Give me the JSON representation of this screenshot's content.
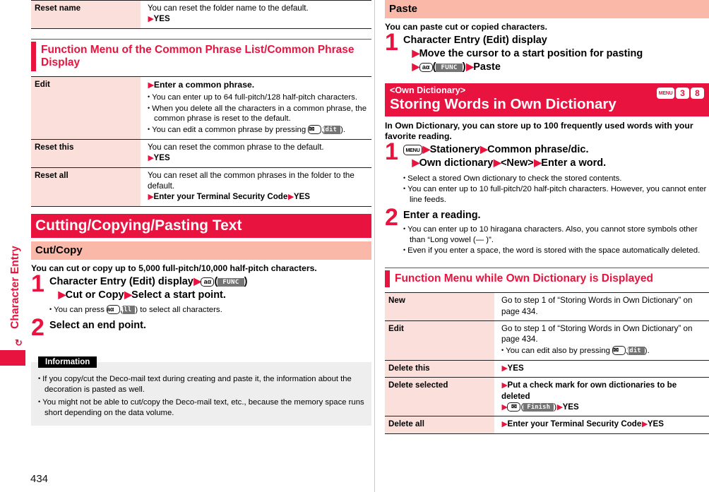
{
  "page": {
    "number": "434",
    "thumb_tab": "Character Entry",
    "accent_red": "#e8133f",
    "key_cell_bg": "#fbdfda",
    "sub_heading_bg": "#fab9a8",
    "info_bg": "#eeeeee"
  },
  "left": {
    "table_top": {
      "rows": [
        {
          "label": "Reset name",
          "lines": [
            "You can reset the folder name to the default.",
            "YES"
          ]
        }
      ]
    },
    "section_heading": "Function Menu of the Common Phrase List/Common Phrase Display",
    "table_fn": {
      "rows": [
        {
          "label": "Edit",
          "headline": "Enter a common phrase.",
          "bullets": [
            "You can enter up to 64 full-pitch/128 half-pitch characters.",
            "When you delete all the characters in a common phrase, the common phrase is reset to the default.",
            "You can edit a common phrase by pressing"
          ],
          "bullet3_key": "mail-key",
          "bullet3_soft": "Edit",
          "bullet3_tail": "."
        },
        {
          "label": "Reset this",
          "line1": "You can reset the common phrase to the default.",
          "line2": "YES"
        },
        {
          "label": "Reset all",
          "line1": "You can reset all the common phrases in the folder to the default.",
          "line2a": "Enter your Terminal Security Code",
          "line2b": "YES"
        }
      ]
    },
    "chapter_heading": "Cutting/Copying/Pasting Text",
    "sub_heading": "Cut/Copy",
    "lead": "You can cut or copy up to 5,000 full-pitch/10,000 half-pitch characters.",
    "step1": {
      "num": "1",
      "line1_a": "Character Entry (Edit) display",
      "line1_key": "i-alpha-key",
      "line1_soft": "FUNC",
      "line2_a": "Cut or Copy",
      "line2_b": "Select a start point.",
      "bullet_a": "You can press",
      "bullet_key": "i-alpha-key",
      "bullet_soft": "All",
      "bullet_b": ") to select all characters."
    },
    "step2": {
      "num": "2",
      "title": "Select an end point."
    },
    "information": {
      "badge": "Information",
      "bullets": [
        "If you copy/cut the Deco-mail text during creating and paste it, the information about the decoration is pasted as well.",
        "You might not be able to cut/copy the Deco-mail text, etc., because the memory space runs short depending on the data volume."
      ]
    }
  },
  "right": {
    "paste_heading": "Paste",
    "paste_lead": "You can paste cut or copied characters.",
    "paste_step": {
      "num": "1",
      "line1": "Character Entry (Edit) display",
      "line2": "Move the cursor to a start position for pasting",
      "line3_key": "i-alpha-key",
      "line3_soft": "FUNC",
      "line3_tail": "Paste"
    },
    "own_dict_header": {
      "sub": "<Own Dictionary>",
      "main": "Storing Words in Own Dictionary",
      "keys": [
        "MENU",
        "3",
        "8"
      ]
    },
    "own_dict_lead": "In Own Dictionary, you can store up to 100 frequently used words with your favorite reading.",
    "own_step1": {
      "num": "1",
      "key": "menu-key",
      "a": "Stationery",
      "b": "Common phrase/dic.",
      "c": "Own dictionary",
      "d": "<New>",
      "e": "Enter a word.",
      "bullets": [
        "Select a stored Own dictionary to check the stored contents.",
        "You can enter up to 10 full-pitch/20 half-pitch characters. However, you cannot enter line feeds."
      ]
    },
    "own_step2": {
      "num": "2",
      "title": "Enter a reading.",
      "bullets": [
        "You can enter up to 10 hiragana characters. Also, you cannot store symbols other than “Long vowel (— )”.",
        "Even if you enter a space, the word is stored with the space automatically deleted."
      ]
    },
    "fn_menu_heading": "Function Menu while Own Dictionary is Displayed",
    "fn_table": {
      "rows": [
        {
          "label": "New",
          "line1": "Go to step 1 of “Storing Words in Own Dictionary” on page 434."
        },
        {
          "label": "Edit",
          "line1": "Go to step 1 of “Storing Words in Own Dictionary” on page 434.",
          "bullet": "You can edit also by pressing",
          "bullet_soft": "Edit",
          "bullet_tail": "."
        },
        {
          "label": "Delete this",
          "line1": "YES"
        },
        {
          "label": "Delete selected",
          "line1": "Put a check mark for own dictionaries to be deleted",
          "line2_soft": "Finish",
          "line2_tail": "YES"
        },
        {
          "label": "Delete all",
          "line1a": "Enter your Terminal Security Code",
          "line1b": "YES"
        }
      ]
    }
  }
}
